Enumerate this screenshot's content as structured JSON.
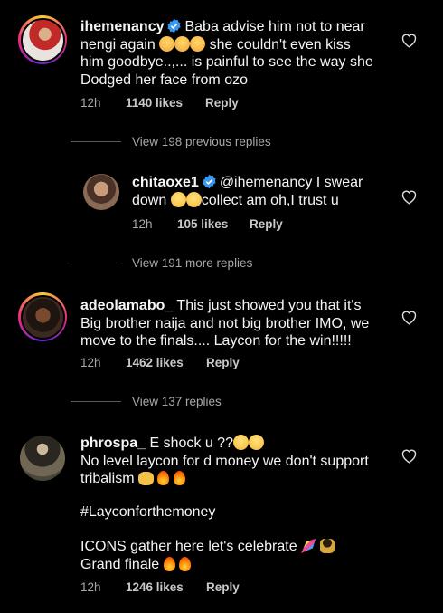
{
  "comments": [
    {
      "username": "ihemenancy",
      "verified": true,
      "text_lines": [
        "Baba advise him not to near",
        "nengi again",
        "she couldn't even kiss",
        "him goodbye..,... is painful to see the way she",
        "Dodged her face from ozo"
      ],
      "time": "12h",
      "likes": "1140 likes",
      "reply": "Reply"
    },
    {
      "username": "chitaoxe1",
      "verified": true,
      "mention": "@ihemenancy",
      "text_lines": [
        "I swear",
        "down",
        "collect am oh,I trust u"
      ],
      "time": "12h",
      "likes": "105 likes",
      "reply": "Reply"
    },
    {
      "username": "adeolamabo_",
      "verified": false,
      "text_lines": [
        "This just showed you that it's",
        "Big brother naija and not big brother IMO, we",
        "move to the finals.... Laycon for the win!!!!!"
      ],
      "time": "12h",
      "likes": "1462 likes",
      "reply": "Reply"
    },
    {
      "username": "phrospa_",
      "verified": false,
      "text_lines": [
        "E shock u ??",
        "No level laycon for d money we don't support",
        "tribalism",
        "#Layconforthemoney",
        "ICONS gather here let's celebrate",
        "Grand finale"
      ],
      "time": "12h",
      "likes": "1246 likes",
      "reply": "Reply"
    }
  ],
  "view_replies": [
    "View 198 previous replies",
    "View 191 more replies",
    "View 137 replies"
  ],
  "icons": {
    "verified": "verified-badge-icon",
    "like": "heart-outline-icon"
  },
  "colors": {
    "background": "#000000",
    "text": "#f5f5f5",
    "muted": "#a8a8a8",
    "verified": "#3897f0"
  }
}
